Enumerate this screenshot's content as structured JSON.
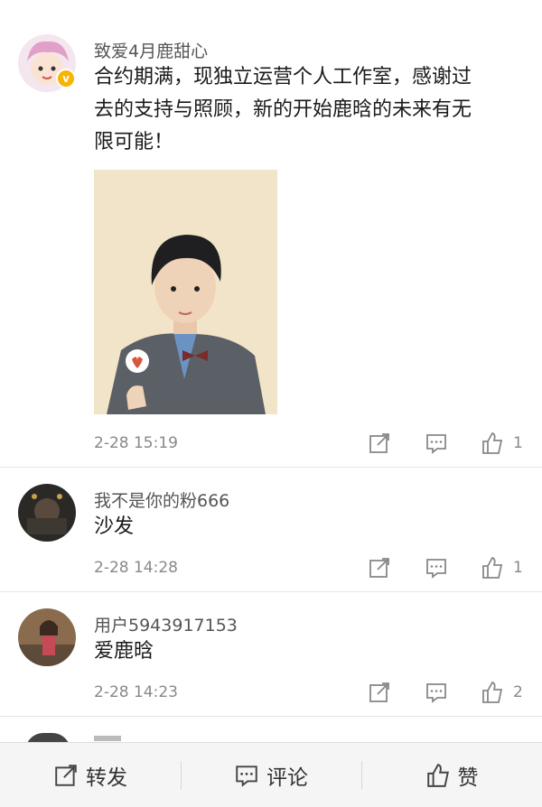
{
  "post": {
    "username": "致爱4月鹿甜心",
    "text_lines": [
      "合约期满，现独立运营个人工作室，感谢过",
      "去的支持与照顾，新的开始鹿晗的未来有无",
      "限可能！"
    ],
    "timestamp": "2-28 15:19",
    "like_count": "1",
    "verified_badge": "v"
  },
  "comments": [
    {
      "username": "我不是你的粉666",
      "text": "沙发",
      "timestamp": "2-28 14:28",
      "like_count": "1"
    },
    {
      "username": "用户5943917153",
      "text": "爱鹿晗",
      "timestamp": "2-28 14:23",
      "like_count": "2"
    }
  ],
  "bottom_bar": {
    "repost_label": "转发",
    "comment_label": "评论",
    "like_label": "赞"
  },
  "icons": {
    "share": "share-icon",
    "comment": "comment-icon",
    "like": "thumbs-up-icon"
  },
  "colors": {
    "text_main": "#1a1a1a",
    "text_meta": "#888888",
    "bar_bg": "#f5f5f5",
    "photo_bg": "#f1e4c8",
    "verified": "#f7b500"
  }
}
